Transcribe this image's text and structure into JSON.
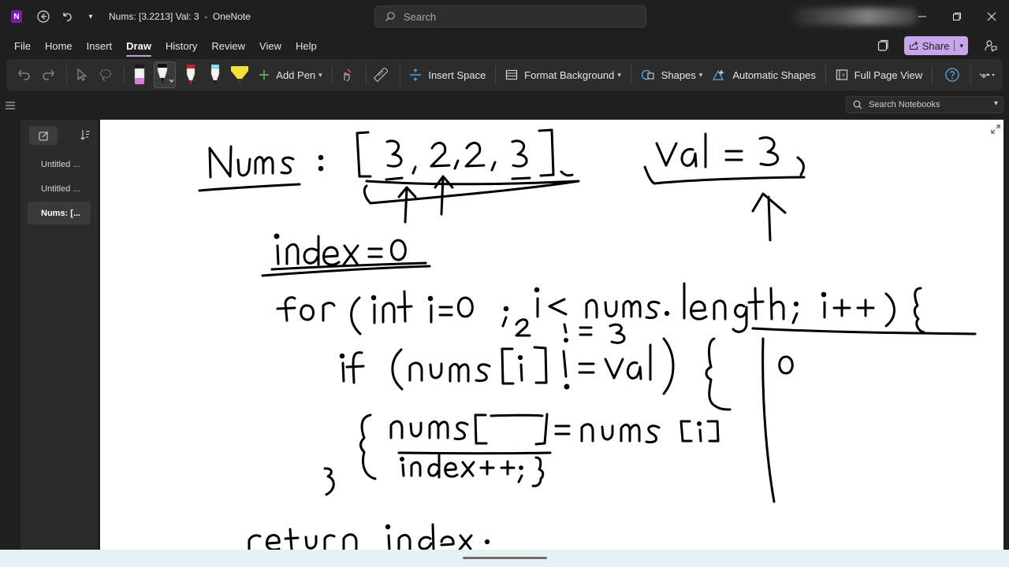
{
  "window": {
    "title": "Nums: [3.2213] Val: 3",
    "app_name": "OneNote",
    "title_separator": "-",
    "logo_letter": "N",
    "search_placeholder": "Search"
  },
  "menu": {
    "items": [
      "File",
      "Home",
      "Insert",
      "Draw",
      "History",
      "Review",
      "View",
      "Help"
    ],
    "active": "Draw",
    "share_label": "Share"
  },
  "ribbon": {
    "add_pen": "Add Pen",
    "insert_space": "Insert Space",
    "format_background": "Format Background",
    "shapes": "Shapes",
    "automatic_shapes": "Automatic Shapes",
    "full_page_view": "Full Page View",
    "pens": [
      {
        "name": "black-pink-pen",
        "tip": "#1a1a1a",
        "band": "#e07ad8"
      },
      {
        "name": "black-pen",
        "tip": "#111111",
        "band": "#ffffff"
      },
      {
        "name": "red-pen",
        "tip": "#d11a2a",
        "band": "#ffffff"
      },
      {
        "name": "cyan-pen",
        "tip": "#1a1a1a",
        "band": "#7fe3f0"
      },
      {
        "name": "yellow-highlighter",
        "tip": "#f4e23a",
        "band": "#f4e23a"
      }
    ]
  },
  "subbar": {
    "search_notebooks": "Search Notebooks"
  },
  "sidebar": {
    "pages": [
      "Untitled ...",
      "Untitled ...",
      "Nums: [..."
    ],
    "selected_index": 2
  },
  "canvas": {
    "ink_texts": {
      "nums_label": "Nums :",
      "array": "[3,2,2,3]",
      "val": "val = 3",
      "index_init": "index = 0",
      "for_loop": "for (int i=0 ; i< nums. length; i++) {",
      "annotation_2": "2",
      "annotation_neq3": "!= 3",
      "if_stmt": "if (nums[i] != val) {",
      "assign": "nums[index] = nums[i]",
      "increment": "index++; }",
      "close_brace": "}",
      "result_zero": "0",
      "return_stmt": "return index ;"
    }
  },
  "colors": {
    "accent": "#c8a5ea",
    "app_logo": "#7719aa",
    "ink": "#000000"
  }
}
